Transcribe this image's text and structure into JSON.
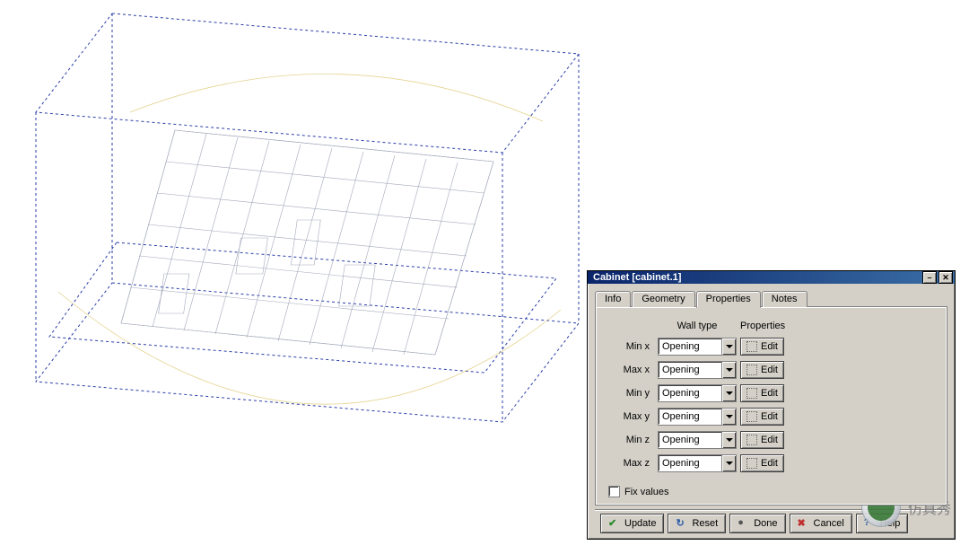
{
  "viewport": {
    "model_desc": "wireframe component inside dashed blue bounding box"
  },
  "dialog": {
    "title": "Cabinet [cabinet.1]",
    "tabs": [
      "Info",
      "Geometry",
      "Properties",
      "Notes"
    ],
    "active_tab": "Properties",
    "headers": {
      "wall_type": "Wall type",
      "properties": "Properties"
    },
    "rows": [
      {
        "label": "Min x",
        "wall_type": "Opening",
        "edit": "Edit"
      },
      {
        "label": "Max x",
        "wall_type": "Opening",
        "edit": "Edit"
      },
      {
        "label": "Min y",
        "wall_type": "Opening",
        "edit": "Edit"
      },
      {
        "label": "Max y",
        "wall_type": "Opening",
        "edit": "Edit"
      },
      {
        "label": "Min z",
        "wall_type": "Opening",
        "edit": "Edit"
      },
      {
        "label": "Max z",
        "wall_type": "Opening",
        "edit": "Edit"
      }
    ],
    "fix_values_label": "Fix values",
    "fix_values_checked": false,
    "buttons": {
      "update": "Update",
      "reset": "Reset",
      "done": "Done",
      "cancel": "Cancel",
      "help": "Help"
    }
  },
  "watermark": {
    "text": "仿真秀"
  }
}
